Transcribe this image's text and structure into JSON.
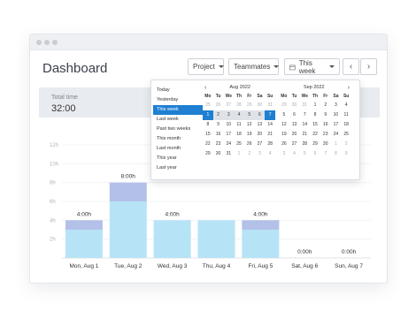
{
  "app": {
    "title": "Dashboard"
  },
  "toolbar": {
    "project": "Project",
    "teammates": "Teammates",
    "period": "This week",
    "prev": "‹",
    "next": "›"
  },
  "summary": {
    "label": "Total time",
    "value": "32:00"
  },
  "date_picker": {
    "ranges": [
      "Today",
      "Yesterday",
      "This week",
      "Last week",
      "Past two weeks",
      "This month",
      "Last month",
      "This year",
      "Last year"
    ],
    "selected_range": "This week",
    "weekdays": [
      "Mo",
      "Tu",
      "We",
      "Th",
      "Fr",
      "Sa",
      "Su"
    ],
    "months": [
      {
        "label": "Aug 2022",
        "prev": "‹",
        "next": "",
        "weeks": [
          [
            "25",
            "26",
            "27",
            "28",
            "29",
            "30",
            "31"
          ],
          [
            "1",
            "2",
            "3",
            "4",
            "5",
            "6",
            "7"
          ],
          [
            "8",
            "9",
            "10",
            "11",
            "12",
            "13",
            "14"
          ],
          [
            "15",
            "16",
            "17",
            "18",
            "19",
            "20",
            "21"
          ],
          [
            "22",
            "23",
            "24",
            "25",
            "26",
            "27",
            "28"
          ],
          [
            "29",
            "30",
            "31",
            "1",
            "2",
            "3",
            "4"
          ]
        ]
      },
      {
        "label": "Sep 2022",
        "prev": "",
        "next": "›",
        "weeks": [
          [
            "29",
            "30",
            "31",
            "1",
            "2",
            "3",
            "4"
          ],
          [
            "5",
            "6",
            "7",
            "8",
            "9",
            "10",
            "11"
          ],
          [
            "12",
            "13",
            "14",
            "15",
            "16",
            "17",
            "18"
          ],
          [
            "19",
            "20",
            "21",
            "22",
            "23",
            "24",
            "25"
          ],
          [
            "26",
            "27",
            "28",
            "29",
            "30",
            "1",
            "2"
          ],
          [
            "3",
            "4",
            "5",
            "6",
            "7",
            "8",
            "9"
          ]
        ]
      }
    ]
  },
  "chart_data": {
    "type": "bar",
    "categories": [
      "Mon, Aug 1",
      "Tue, Aug 2",
      "Wed, Aug 3",
      "Thu, Aug 4",
      "Fri, Aug 5",
      "Sat, Aug 6",
      "Sun, Aug 7"
    ],
    "series": [
      {
        "values": [
          3,
          6,
          4,
          4,
          3,
          0,
          0
        ],
        "color": "#b7e3f6"
      },
      {
        "values": [
          1,
          2,
          0,
          0,
          1,
          0,
          0
        ],
        "color": "#b3c1e8"
      }
    ],
    "totals": [
      "4:00h",
      "8:00h",
      "4:00h",
      "",
      "4:00h",
      "0:00h",
      "0:00h"
    ],
    "yticks": [
      "2h",
      "4h",
      "6h",
      "8h",
      "10h",
      "12h"
    ],
    "ylim": [
      0,
      12
    ]
  }
}
